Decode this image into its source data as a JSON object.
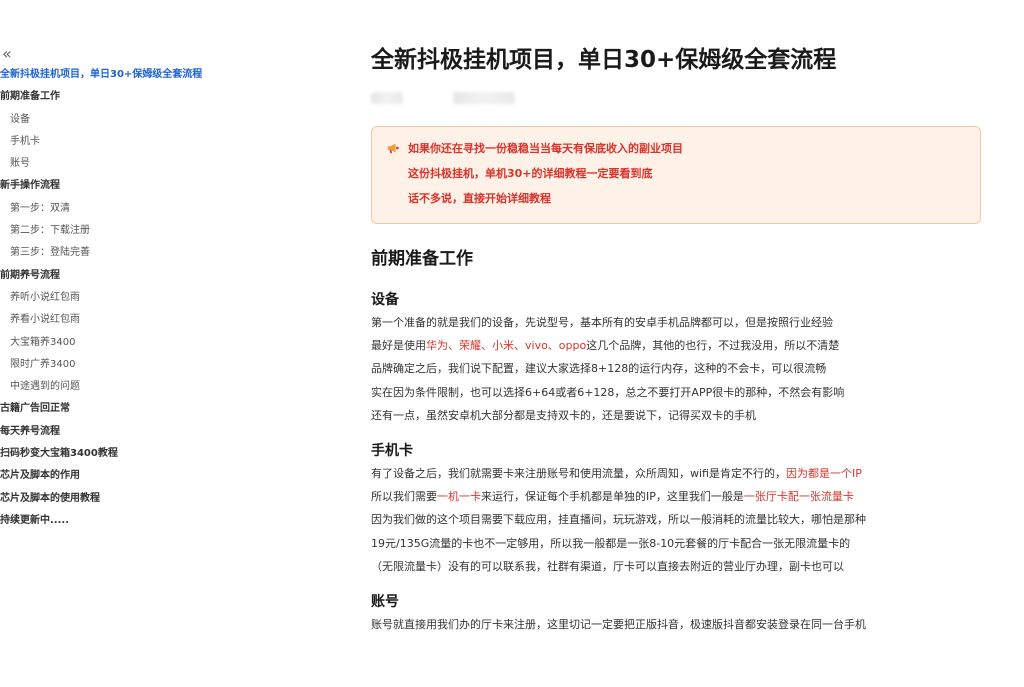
{
  "toc": {
    "collapse_glyph": "«",
    "items": [
      {
        "label": "全新抖极挂机项目，单日30+保姆级全套流程",
        "level": 1,
        "active": true
      },
      {
        "label": "前期准备工作",
        "level": 1
      },
      {
        "label": "设备",
        "level": 2
      },
      {
        "label": "手机卡",
        "level": 2
      },
      {
        "label": "账号",
        "level": 2
      },
      {
        "label": "新手操作流程",
        "level": 1
      },
      {
        "label": "第一步：双清",
        "level": 2
      },
      {
        "label": "第二步：下载注册",
        "level": 2
      },
      {
        "label": "第三步：登陆完善",
        "level": 2
      },
      {
        "label": "前期养号流程",
        "level": 1
      },
      {
        "label": "养听小说红包雨",
        "level": 2
      },
      {
        "label": "养看小说红包雨",
        "level": 2
      },
      {
        "label": "大宝箱养3400",
        "level": 2
      },
      {
        "label": "限时广养3400",
        "level": 2
      },
      {
        "label": "中途遇到的问题",
        "level": 2
      },
      {
        "label": "古籍广告回正常",
        "level": 1
      },
      {
        "label": "每天养号流程",
        "level": 1
      },
      {
        "label": "扫码秒变大宝箱3400教程",
        "level": 1
      },
      {
        "label": "芯片及脚本的作用",
        "level": 1
      },
      {
        "label": "芯片及脚本的使用教程",
        "level": 1
      },
      {
        "label": "持续更新中.....",
        "level": 1
      }
    ]
  },
  "article": {
    "title": "全新抖极挂机项目，单日30+保姆级全套流程",
    "callout": {
      "icon": "megaphone-icon",
      "lines": [
        "如果你还在寻找一份稳稳当当每天有保底收入的副业项目",
        "这份抖极挂机，单机30+的详细教程一定要看到底",
        "话不多说，直接开始详细教程"
      ]
    },
    "section1": {
      "heading": "前期准备工作",
      "device": {
        "heading": "设备",
        "l1": "第一个准备的就是我们的设备，先说型号，基本所有的安卓手机品牌都可以，但是按照行业经验",
        "l2a": "最好是使用",
        "l2b": "华为、荣耀、小米、vivo、oppo",
        "l2c": "这几个品牌，其他的也行，不过我没用，所以不清楚",
        "l3": "品牌确定之后，我们说下配置，建议大家选择8+128的运行内存，这种的不会卡，可以很流畅",
        "l4": "实在因为条件限制，也可以选择6+64或者6+128，总之不要打开APP很卡的那种，不然会有影响",
        "l5": "还有一点，虽然安卓机大部分都是支持双卡的，还是要说下，记得买双卡的手机"
      },
      "sim": {
        "heading": "手机卡",
        "l1a": "有了设备之后，我们就需要卡来注册账号和使用流量，众所周知，wifi是肯定不行的，",
        "l1b": "因为都是一个IP",
        "l2a": "所以我们需要",
        "l2b": "一机一卡",
        "l2c": "来运行，保证每个手机都是单独的IP，这里我们一般是",
        "l2d": "一张厅卡配一张流量卡",
        "l3": "因为我们做的这个项目需要下载应用，挂直播间，玩玩游戏，所以一般消耗的流量比较大，哪怕是那种",
        "l4": "19元/135G流量的卡也不一定够用，所以我一般都是一张8-10元套餐的厅卡配合一张无限流量卡的",
        "l5": "（无限流量卡）没有的可以联系我，社群有渠道，厅卡可以直接去附近的营业厅办理，副卡也可以"
      },
      "account": {
        "heading": "账号",
        "l1": "账号就直接用我们办的厅卡来注册，这里切记一定要把正版抖音，极速版抖音都安装登录在同一台手机"
      }
    }
  }
}
